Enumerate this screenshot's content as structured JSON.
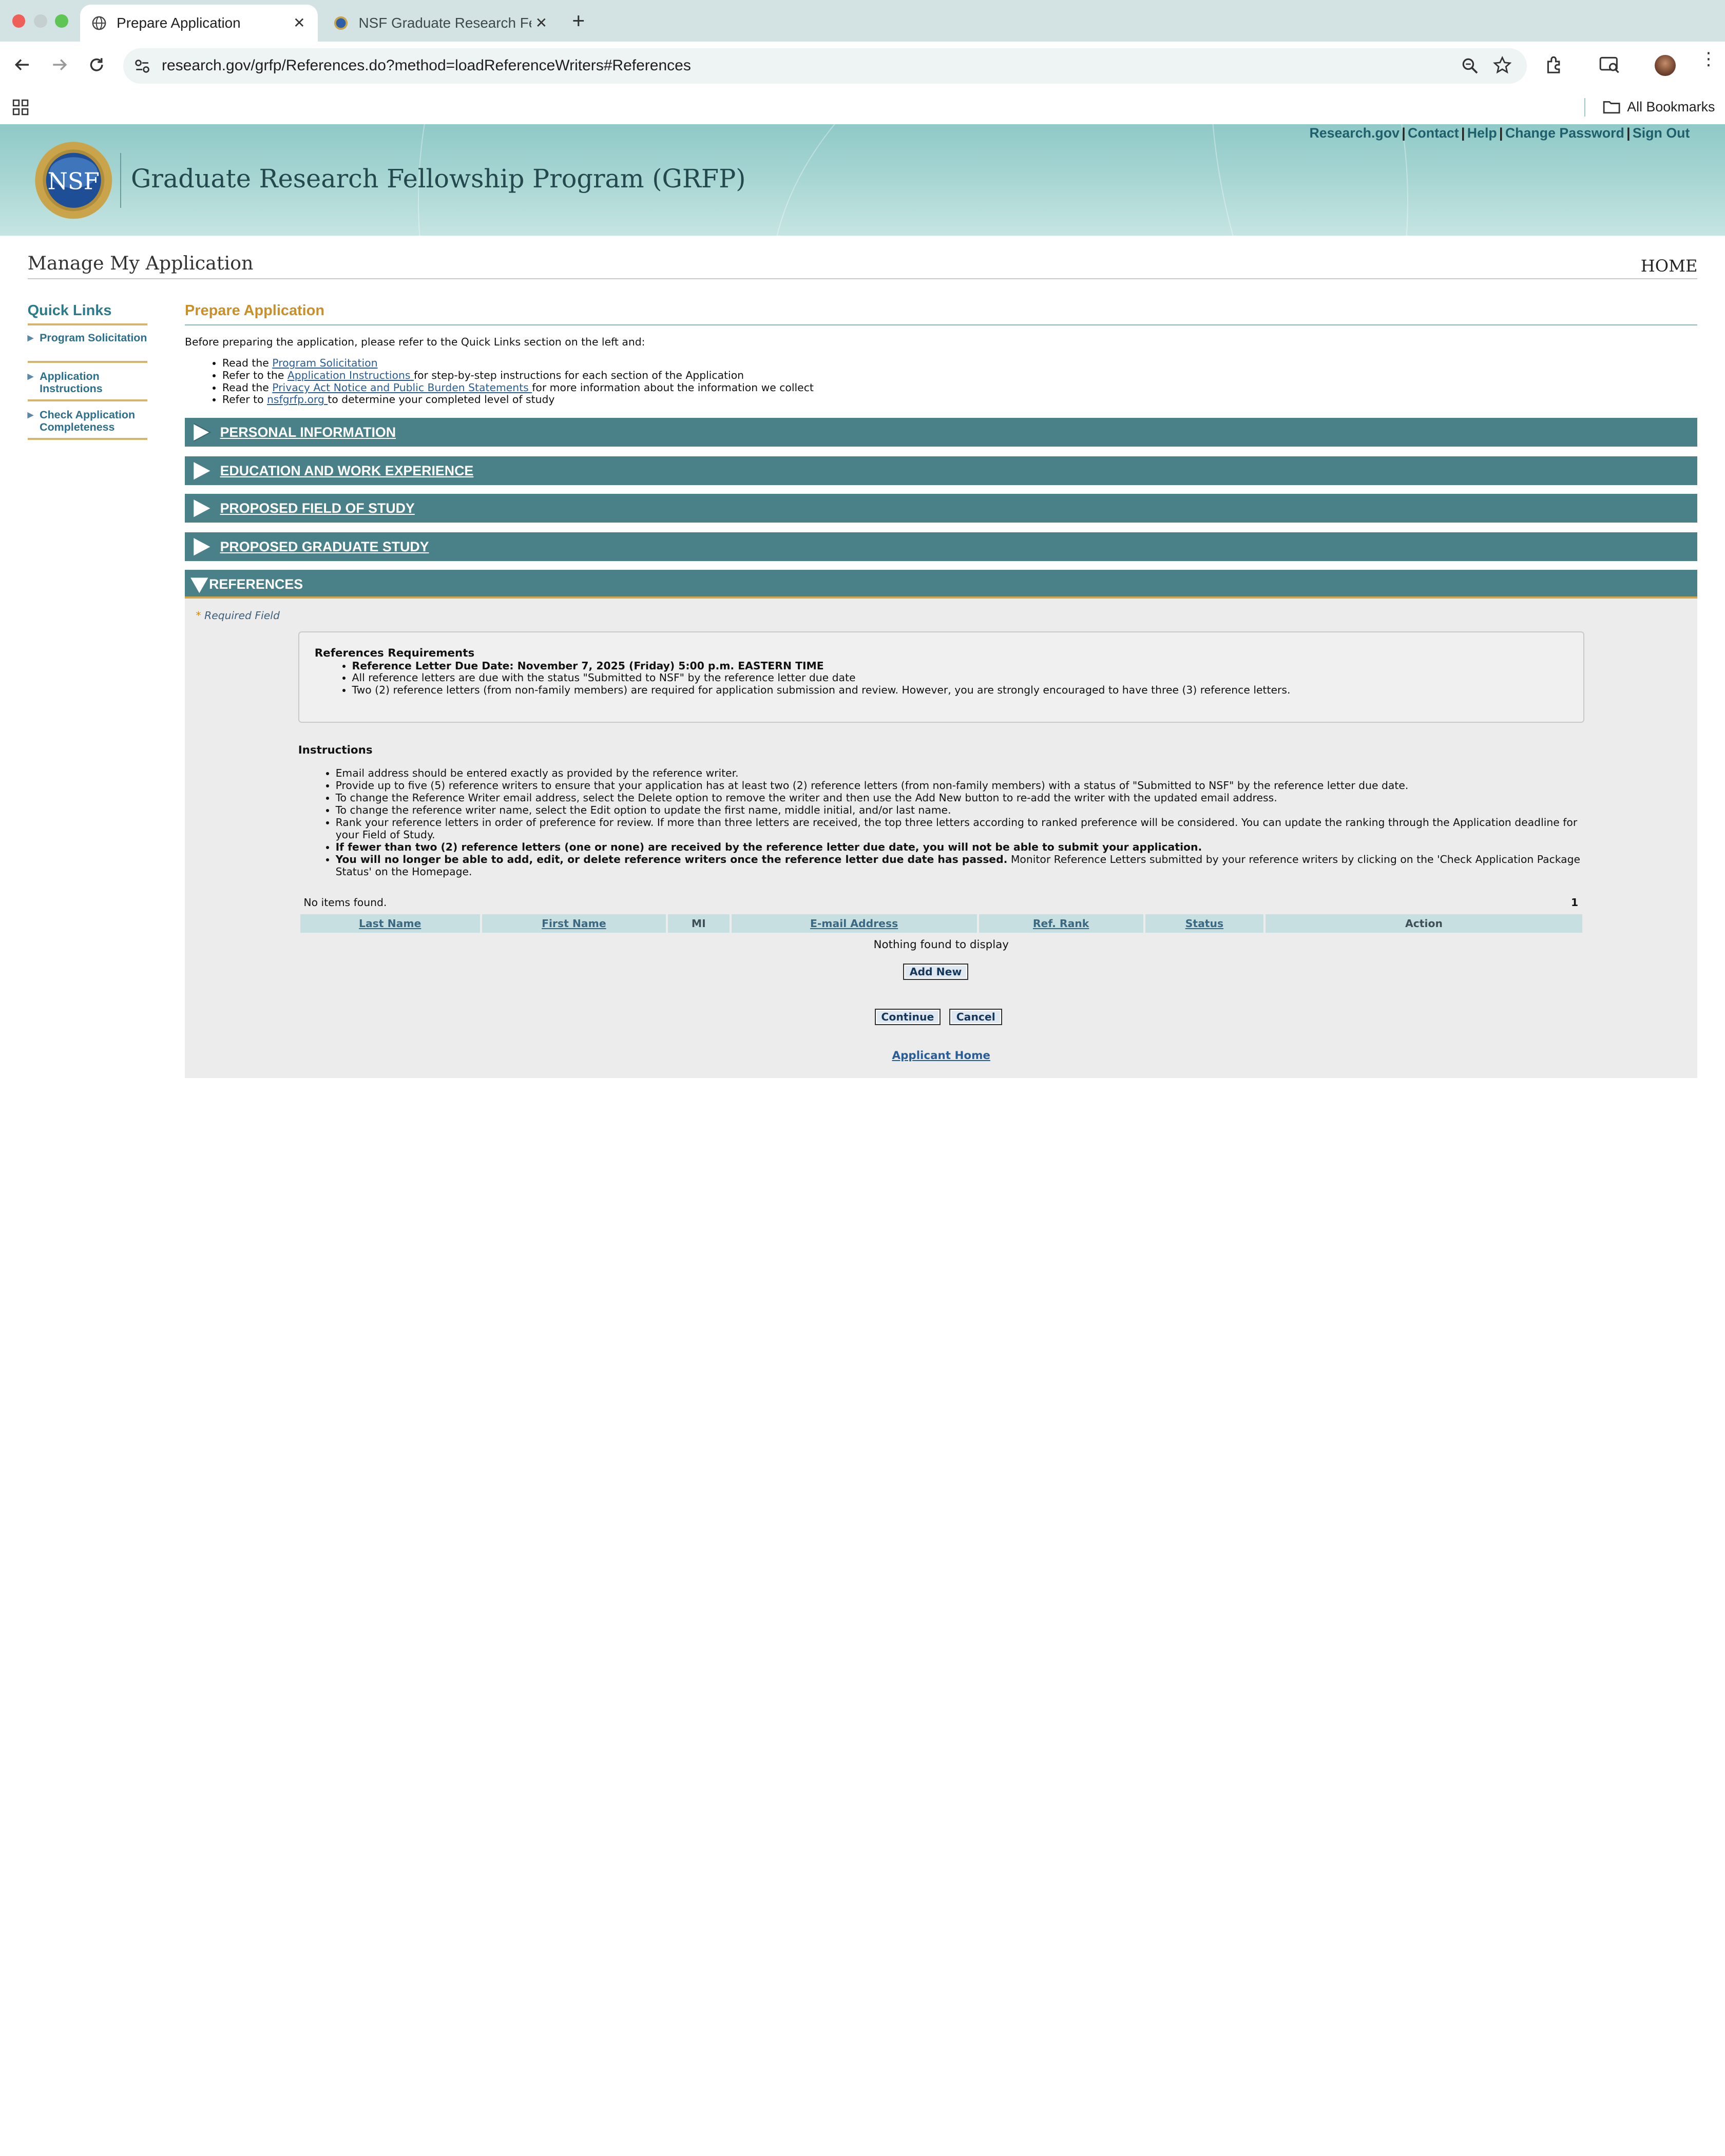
{
  "browser": {
    "tabs": [
      {
        "title": "Prepare Application",
        "active": true
      },
      {
        "title": "NSF Graduate Research Fello",
        "active": false
      }
    ],
    "url": "research.gov/grfp/References.do?method=loadReferenceWriters#References",
    "bookmarks_label": "All Bookmarks"
  },
  "site": {
    "logo_text": "NSF",
    "title": "Graduate Research Fellowship Program (GRFP)",
    "top_links": [
      "Research.gov",
      "Contact",
      "Help",
      "Change Password",
      "Sign Out"
    ]
  },
  "page": {
    "heading": "Manage My Application",
    "home_link": "HOME"
  },
  "quick_links": {
    "title": "Quick Links",
    "items": [
      {
        "label": "Program Solicitation"
      },
      {
        "label": "Application Instructions"
      },
      {
        "label": "Check Application Completeness"
      }
    ]
  },
  "main": {
    "title": "Prepare Application",
    "intro": "Before preparing the application, please refer to the Quick Links section on the left and:",
    "bullets": [
      {
        "pre": "Read the ",
        "link": "Program Solicitation",
        "post": ""
      },
      {
        "pre": "Refer to the ",
        "link": "Application Instructions ",
        "post": "for step-by-step instructions for each section of the Application"
      },
      {
        "pre": "Read the ",
        "link": "Privacy Act Notice and Public Burden Statements ",
        "post": "for more information about the information we collect"
      },
      {
        "pre": "Refer to ",
        "link": "nsfgrfp.org ",
        "post": "to determine your completed level of study"
      }
    ],
    "sections": [
      {
        "label": "PERSONAL INFORMATION",
        "open": false
      },
      {
        "label": "EDUCATION AND WORK EXPERIENCE",
        "open": false
      },
      {
        "label": "PROPOSED FIELD OF STUDY",
        "open": false
      },
      {
        "label": "PROPOSED GRADUATE STUDY",
        "open": false
      },
      {
        "label": "REFERENCES",
        "open": true
      }
    ]
  },
  "references": {
    "required_note": "Required Field",
    "requirements_title": "References Requirements",
    "requirements": [
      "Reference Letter Due Date: November 7, 2025 (Friday) 5:00 p.m. EASTERN TIME",
      "All reference letters are due with the status \"Submitted to NSF\" by the reference letter due date",
      "Two (2) reference letters (from non-family members) are required for application submission and review. However, you are strongly encouraged to have three (3) reference letters."
    ],
    "instructions_title": "Instructions",
    "instructions": [
      {
        "bold": "",
        "text": "Email address should be entered exactly as provided by the reference writer."
      },
      {
        "bold": "",
        "text": "Provide up to five (5) reference writers to ensure that your application has at least two (2) reference letters (from non-family members) with a status of \"Submitted to NSF\" by the reference letter due date."
      },
      {
        "bold": "",
        "text": "To change the Reference Writer email address, select the Delete option to remove the writer and then use the Add New button to re-add the writer with the updated email address."
      },
      {
        "bold": "",
        "text": "To change the reference writer name, select the Edit option to update the first name, middle initial, and/or last name."
      },
      {
        "bold": "",
        "text": "Rank your reference letters in order of preference for review. If more than three letters are received, the top three letters according to ranked preference will be considered. You can update the ranking through the Application deadline for your Field of Study."
      },
      {
        "bold": "If fewer than two (2) reference letters (one or none) are received by the reference letter due date, you will not be able to submit your application.",
        "text": ""
      },
      {
        "bold": "You will no longer be able to add, edit, or delete reference writers once the reference letter due date has passed.",
        "text": " Monitor Reference Letters submitted by your reference writers by clicking on the 'Check Application Package Status' on the Homepage."
      }
    ],
    "no_items": "No items found.",
    "page_number": "1",
    "columns": [
      "Last Name",
      "First Name",
      "MI",
      "E-mail Address",
      "Ref. Rank",
      "Status",
      "Action"
    ],
    "empty_message": "Nothing found to display",
    "add_new_label": "Add New",
    "continue_label": "Continue",
    "cancel_label": "Cancel",
    "applicant_home_label": "Applicant Home"
  }
}
